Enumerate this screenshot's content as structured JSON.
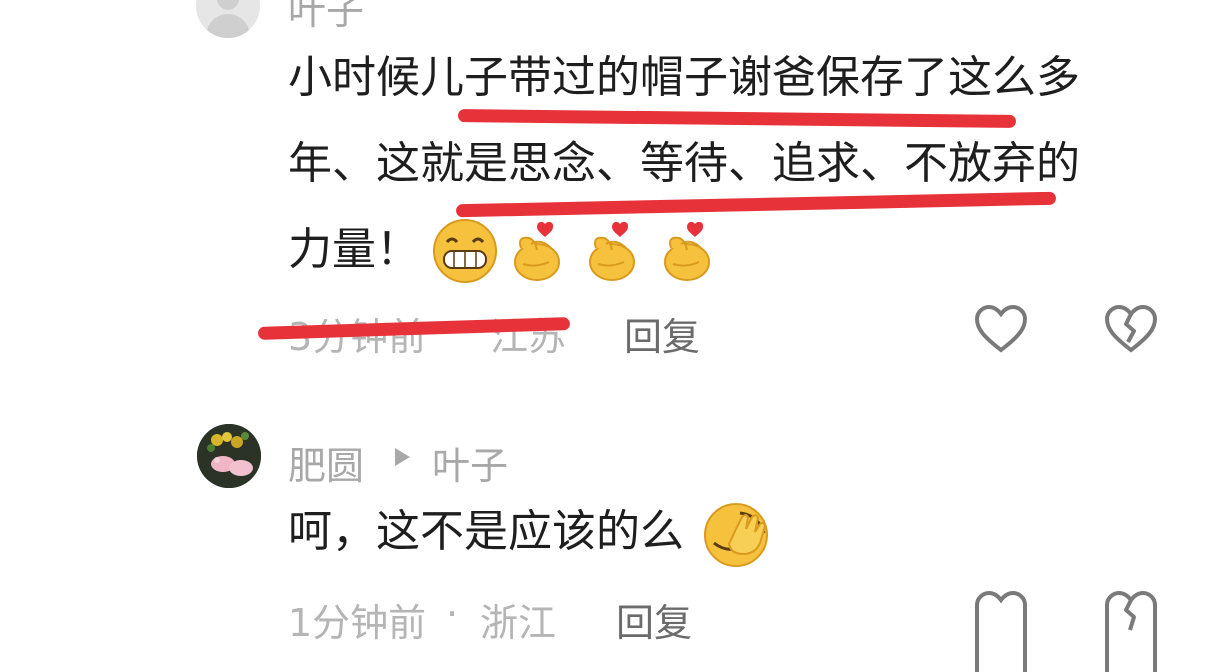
{
  "comment1": {
    "username": "叶子",
    "lines": [
      "小时候儿子带过的帽子谢爸保存了这么多",
      "年、这就是思念、等待、追求、不放弃的",
      "力量！"
    ],
    "emojis": [
      "grin-emoji",
      "finger-heart-emoji",
      "finger-heart-emoji",
      "finger-heart-emoji"
    ],
    "time": "3分钟前",
    "location": "江苏",
    "reply_label": "回复"
  },
  "comment2": {
    "username": "肥圆",
    "reply_to": "叶子",
    "text": "呵，这不是应该的么",
    "emoji": "face-palm-emoji",
    "time": "1分钟前",
    "separator": "·",
    "location": "浙江",
    "reply_label": "回复"
  },
  "colors": {
    "annotation_red": "#e8323a",
    "text": "#1e1e1e",
    "muted": "#b5b5b5",
    "emoji_yellow": "#f6c23e"
  }
}
